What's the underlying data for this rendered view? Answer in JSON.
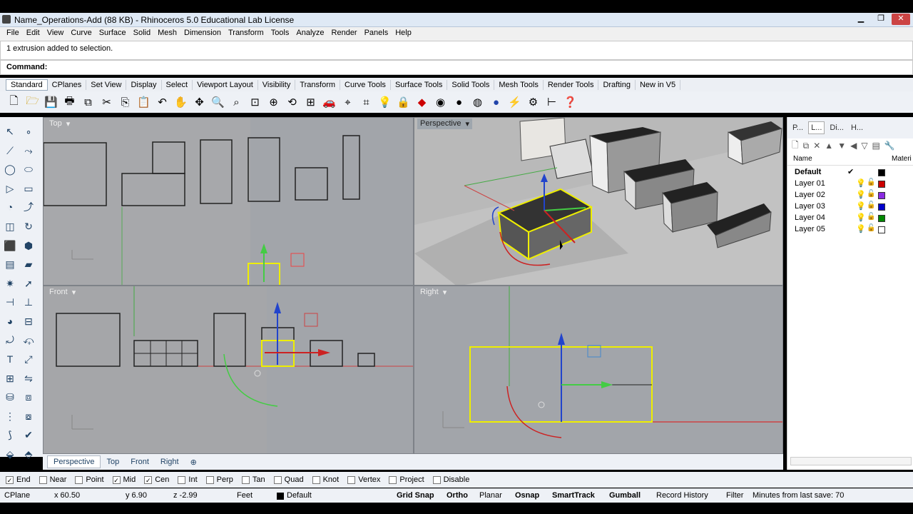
{
  "window": {
    "title": "Name_Operations-Add (88 KB) - Rhinoceros 5.0 Educational Lab License"
  },
  "menu": [
    "File",
    "Edit",
    "View",
    "Curve",
    "Surface",
    "Solid",
    "Mesh",
    "Dimension",
    "Transform",
    "Tools",
    "Analyze",
    "Render",
    "Panels",
    "Help"
  ],
  "command": {
    "history": "1 extrusion added to selection.",
    "prompt": "Command:"
  },
  "toolbar_tabs": [
    "Standard",
    "CPlanes",
    "Set View",
    "Display",
    "Select",
    "Viewport Layout",
    "Visibility",
    "Transform",
    "Curve Tools",
    "Surface Tools",
    "Solid Tools",
    "Mesh Tools",
    "Render Tools",
    "Drafting",
    "New in V5"
  ],
  "viewports": {
    "top": "Top",
    "perspective": "Perspective",
    "front": "Front",
    "right": "Right"
  },
  "viewport_tabs": [
    "Perspective",
    "Top",
    "Front",
    "Right"
  ],
  "panel": {
    "tabs": [
      "P...",
      "L...",
      "Di...",
      "H..."
    ],
    "col_name": "Name",
    "col_material": "Materi",
    "layers": [
      {
        "name": "Default",
        "current": true,
        "color": "#000000"
      },
      {
        "name": "Layer 01",
        "color": "#cc0000"
      },
      {
        "name": "Layer 02",
        "color": "#8a2be2"
      },
      {
        "name": "Layer 03",
        "color": "#0000cc"
      },
      {
        "name": "Layer 04",
        "color": "#008800"
      },
      {
        "name": "Layer 05",
        "color": "#ffffff"
      }
    ]
  },
  "osnaps": [
    {
      "label": "End",
      "checked": true
    },
    {
      "label": "Near",
      "checked": false
    },
    {
      "label": "Point",
      "checked": false
    },
    {
      "label": "Mid",
      "checked": true
    },
    {
      "label": "Cen",
      "checked": true
    },
    {
      "label": "Int",
      "checked": false
    },
    {
      "label": "Perp",
      "checked": false
    },
    {
      "label": "Tan",
      "checked": false
    },
    {
      "label": "Quad",
      "checked": false
    },
    {
      "label": "Knot",
      "checked": false
    },
    {
      "label": "Vertex",
      "checked": false
    },
    {
      "label": "Project",
      "checked": false
    },
    {
      "label": "Disable",
      "checked": false
    }
  ],
  "status": {
    "cplane": "CPlane",
    "x": "x 60.50",
    "y": "y 6.90",
    "z": "z -2.99",
    "units": "Feet",
    "layer": "Default",
    "grid_snap": "Grid Snap",
    "ortho": "Ortho",
    "planar": "Planar",
    "osnap": "Osnap",
    "smarttrack": "SmartTrack",
    "gumball": "Gumball",
    "record_history": "Record History",
    "filter": "Filter",
    "minutes": "Minutes from last save: 70"
  }
}
